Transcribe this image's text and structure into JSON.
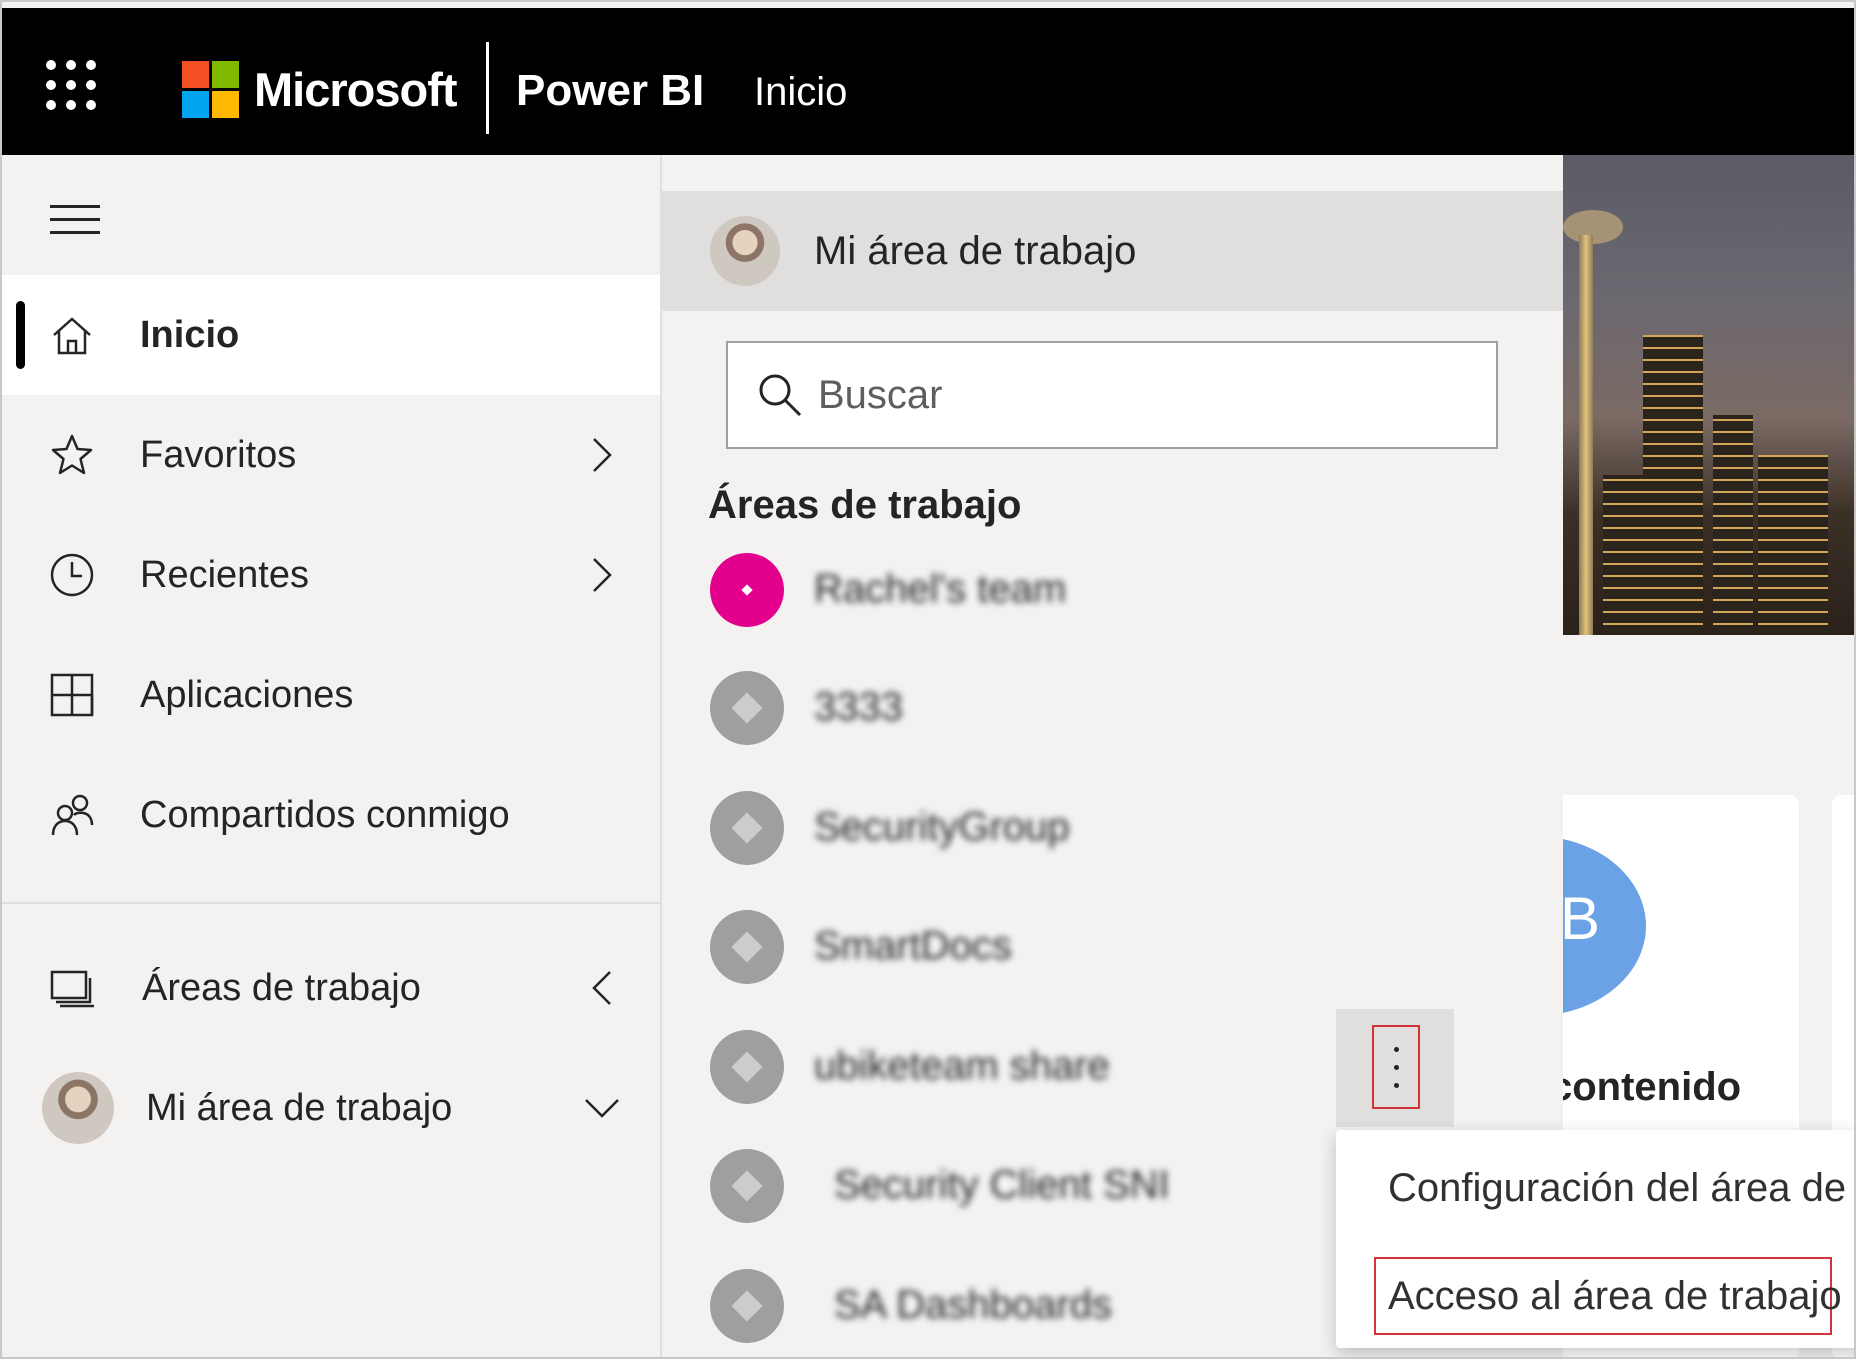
{
  "topbar": {
    "brand": "Microsoft",
    "product": "Power BI",
    "breadcrumb": "Inicio"
  },
  "nav": {
    "items": [
      {
        "label": "Inicio",
        "icon": "home-icon",
        "active": true
      },
      {
        "label": "Favoritos",
        "icon": "star-icon",
        "chevron": "right"
      },
      {
        "label": "Recientes",
        "icon": "clock-icon",
        "chevron": "right"
      },
      {
        "label": "Aplicaciones",
        "icon": "apps-icon"
      },
      {
        "label": "Compartidos conmigo",
        "icon": "shared-people-icon"
      }
    ],
    "workspaces_label": "Áreas de trabajo",
    "workspaces_chevron": "left",
    "my_workspace_label": "Mi área de trabajo",
    "my_workspace_chevron": "down"
  },
  "flyout": {
    "my_workspace": "Mi área de trabajo",
    "search_placeholder": "Buscar",
    "section_title": "Áreas de trabajo",
    "workspaces": [
      {
        "name": "Rachel's team",
        "icon_color": "#e3008c"
      },
      {
        "name": "3333",
        "icon_color": "#a19f9d"
      },
      {
        "name": "SecurityGroup",
        "icon_color": "#a19f9d"
      },
      {
        "name": "SmartDocs",
        "icon_color": "#a19f9d"
      },
      {
        "name": "ubiketeam share",
        "icon_color": "#a19f9d"
      },
      {
        "name": "Security Client SNI",
        "icon_color": "#a19f9d"
      },
      {
        "name": "SA Dashboards",
        "icon_color": "#a19f9d"
      }
    ]
  },
  "context_menu": {
    "items": [
      {
        "label": "Configuración del área de t"
      },
      {
        "label": "Acceso al área de trabajo",
        "highlighted": true
      }
    ]
  },
  "background": {
    "card_letter": "B",
    "card_title": "contenido",
    "card_color": "#6aa2e5"
  },
  "colors": {
    "topbar": "#000000",
    "nav_bg": "#f3f2f1",
    "highlight": "#d13438"
  }
}
